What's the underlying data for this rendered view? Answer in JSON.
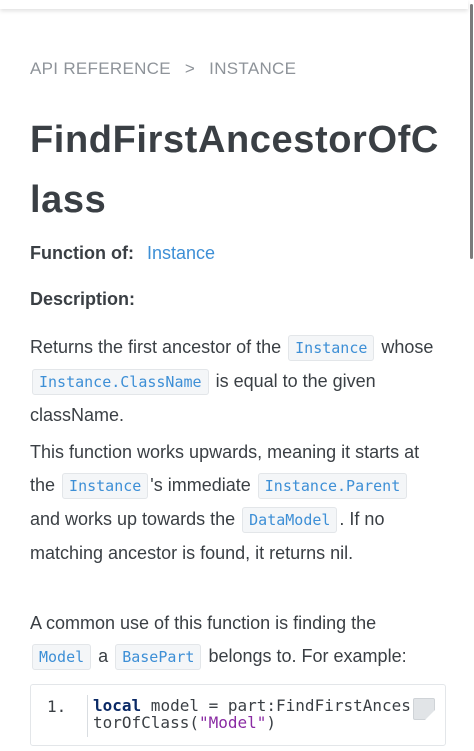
{
  "breadcrumb": {
    "root": "API REFERENCE",
    "separator": ">",
    "current": "INSTANCE"
  },
  "page": {
    "title": "FindFirstAncestorOfClass"
  },
  "meta": {
    "function_of_label": "Function of:",
    "function_of_value": "Instance",
    "description_label": "Description:"
  },
  "para1": {
    "t1": "Returns the first ancestor of the",
    "c1": "Instance",
    "t2": "whose",
    "c2": "Instance.ClassName",
    "t3": "is equal to the given className."
  },
  "para2": {
    "t1": "This function works upwards, meaning it starts at the",
    "c1": "Instance",
    "t2": "'s immediate",
    "c2": "Instance.Parent",
    "t3": "and works up towards the",
    "c3": "DataModel",
    "t4": ". If no matching ancestor is found, it returns nil."
  },
  "para3": {
    "t1": "A common use of this function is finding the",
    "c1": "Model",
    "t2": "a",
    "c2": "BasePart",
    "t3": "belongs to. For example:"
  },
  "code": {
    "line_number": "1.",
    "kw": "local",
    "mid": " model = part:FindFirstAncestorOfClass(",
    "str": "\"Model\"",
    "end": ")"
  },
  "icons": {
    "copy": "copy-icon"
  }
}
